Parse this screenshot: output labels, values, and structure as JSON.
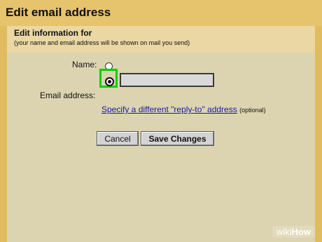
{
  "window": {
    "title": "Edit email address"
  },
  "section": {
    "heading": "Edit information for",
    "subtext": "(your name and email address will be shown on mail you send)"
  },
  "form": {
    "name_label": "Name:",
    "name_radio_1": {
      "selected": false
    },
    "name_radio_2": {
      "selected": true
    },
    "name_input_value": "",
    "email_label": "Email address:",
    "reply_to_link": "Specify a different \"reply-to\" address",
    "reply_to_note": "(optional)"
  },
  "buttons": {
    "cancel": "Cancel",
    "save": "Save Changes"
  },
  "watermark": {
    "part1": "wiki",
    "part2": "How"
  },
  "colors": {
    "highlight": "#00d000",
    "link": "#1a1aa8",
    "titlebar": "#e6c46e",
    "panel": "#dcd4b0"
  }
}
